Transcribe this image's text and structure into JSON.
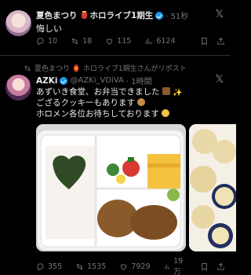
{
  "tweet1": {
    "author_name": "夏色まつり",
    "group": "ホロライブ1期生",
    "time": "· 51秒",
    "text": "悔しい",
    "stats": {
      "replies": "10",
      "reposts": "18",
      "likes": "115",
      "views": "6124"
    }
  },
  "repost_banner": "夏色まつり 🏮 ホロライブ1期生さんがリポスト",
  "tweet2": {
    "author_name": "AZKi",
    "handle": "@AZKi_VDiVA",
    "time": "· 1時間",
    "lines": [
      "あずいき食堂、お弁当できました",
      "ござるクッキーもあります",
      "ホロメン各位お待ちしております"
    ],
    "stats": {
      "replies": "355",
      "reposts": "1535",
      "likes": "7929",
      "views": "19万"
    }
  },
  "colors": {
    "background": "#000000",
    "text": "#e7e9ea",
    "muted": "#71767b",
    "verified": "#1d9bf0",
    "divider": "#2f3336"
  },
  "icons": [
    "x-logo-icon",
    "reply-icon",
    "repost-icon",
    "like-icon",
    "views-icon",
    "bookmark-icon",
    "share-icon",
    "verified-badge-icon",
    "lantern-icon"
  ]
}
